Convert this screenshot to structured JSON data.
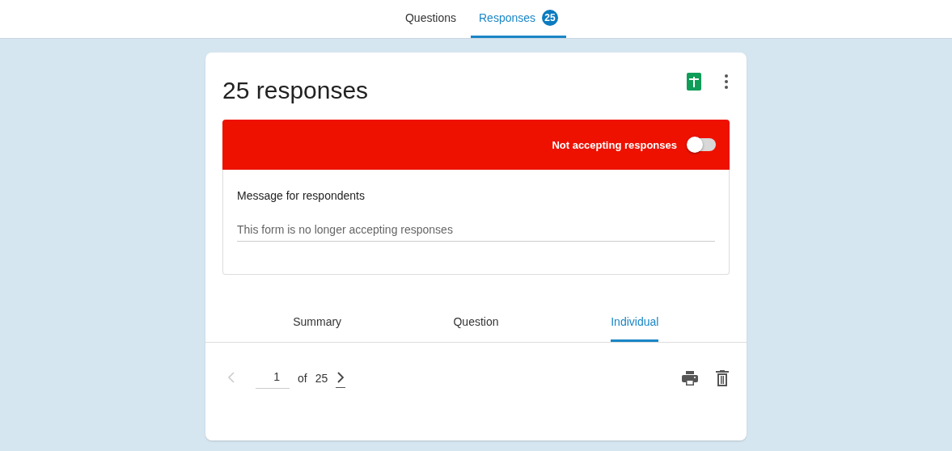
{
  "top_tabs": [
    {
      "label": "Questions",
      "selected": false
    },
    {
      "label": "Responses",
      "selected": true,
      "badge": "25"
    }
  ],
  "title": "25 responses",
  "banner": {
    "label": "Not accepting responses",
    "on": false
  },
  "message": {
    "label": "Message for respondents",
    "value": "This form is no longer accepting responses"
  },
  "view_tabs": [
    {
      "label": "Summary",
      "selected": false
    },
    {
      "label": "Question",
      "selected": false
    },
    {
      "label": "Individual",
      "selected": true
    }
  ],
  "pager": {
    "current": "1",
    "of": "of",
    "total": "25",
    "prev_disabled": true,
    "next_disabled": false
  }
}
